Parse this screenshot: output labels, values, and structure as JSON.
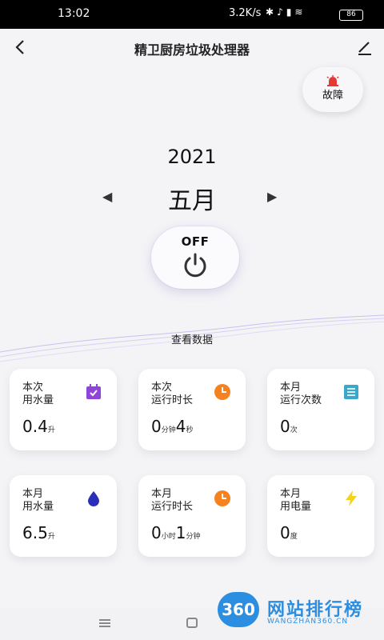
{
  "status_bar": {
    "time": "13:02",
    "net_speed": "3.2K/s",
    "icons": [
      "bluetooth-icon",
      "mute-icon",
      "signal-icon",
      "wifi-icon"
    ],
    "battery": "86"
  },
  "header": {
    "title": "精卫厨房垃圾处理器",
    "back_icon": "back-arrow-icon",
    "edit_icon": "edit-pencil-icon"
  },
  "fault": {
    "label": "故障",
    "icon": "alarm-light-icon",
    "color": "#e53935"
  },
  "date": {
    "year": "2021",
    "month": "五月",
    "prev_icon": "triangle-left-icon",
    "next_icon": "triangle-right-icon"
  },
  "power": {
    "label": "OFF",
    "icon": "power-icon"
  },
  "view_data_label": "查看数据",
  "cards": [
    {
      "label_line1": "本次",
      "label_line2": "用水量",
      "icon": "calendar-check-icon",
      "icon_color": "#8e44d8",
      "parts": [
        {
          "v": "0.4",
          "u": "升"
        }
      ]
    },
    {
      "label_line1": "本次",
      "label_line2": "运行时长",
      "icon": "clock-icon",
      "icon_color": "#f5811f",
      "parts": [
        {
          "v": "0",
          "u": "分钟"
        },
        {
          "v": "4",
          "u": "秒"
        }
      ]
    },
    {
      "label_line1": "本月",
      "label_line2": "运行次数",
      "icon": "list-icon",
      "icon_color": "#3aa8c8",
      "parts": [
        {
          "v": "0",
          "u": "次"
        }
      ]
    },
    {
      "label_line1": "本月",
      "label_line2": "用水量",
      "icon": "water-drop-icon",
      "icon_color": "#2b2fb8",
      "parts": [
        {
          "v": "6.5",
          "u": "升"
        }
      ]
    },
    {
      "label_line1": "本月",
      "label_line2": "运行时长",
      "icon": "clock-icon",
      "icon_color": "#f5811f",
      "parts": [
        {
          "v": "0",
          "u": "小时"
        },
        {
          "v": "1",
          "u": "分钟"
        }
      ]
    },
    {
      "label_line1": "本月",
      "label_line2": "用电量",
      "icon": "lightning-icon",
      "icon_color": "#f6d21b",
      "parts": [
        {
          "v": "0",
          "u": "度"
        }
      ]
    }
  ],
  "watermark": {
    "badge": "360",
    "text": "网站排行榜",
    "sub": "WANGZHAN360.CN"
  }
}
